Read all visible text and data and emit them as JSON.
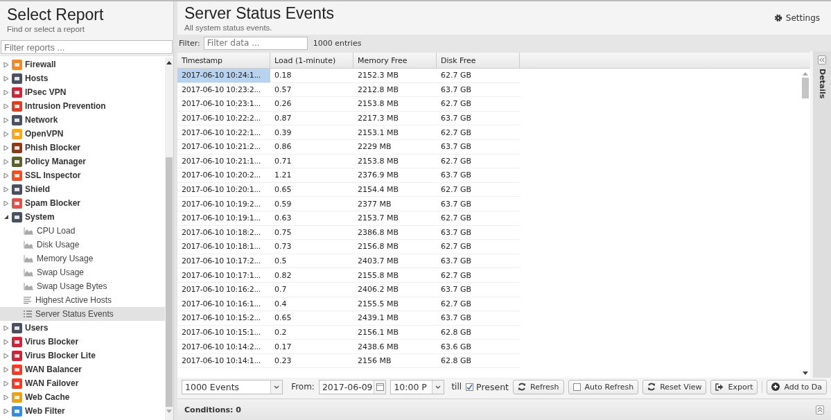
{
  "sidebar": {
    "title": "Select Report",
    "subtitle": "Find or select a report",
    "filter": {
      "placeholder": "Filter reports ..."
    },
    "tree": [
      {
        "label": "Firewall",
        "color": "#f0892c",
        "expanded": false
      },
      {
        "label": "Hosts",
        "color": "#4a5060",
        "expanded": false
      },
      {
        "label": "IPsec VPN",
        "color": "#c8283c",
        "expanded": false
      },
      {
        "label": "Intrusion Prevention",
        "color": "#d8402a",
        "expanded": false
      },
      {
        "label": "Network",
        "color": "#4a5060",
        "expanded": false
      },
      {
        "label": "OpenVPN",
        "color": "#f5a623",
        "expanded": false
      },
      {
        "label": "Phish Blocker",
        "color": "#8a3a1c",
        "expanded": false
      },
      {
        "label": "Policy Manager",
        "color": "#5a6030",
        "expanded": false
      },
      {
        "label": "SSL Inspector",
        "color": "#e8502a",
        "expanded": false
      },
      {
        "label": "Shield",
        "color": "#4a5060",
        "expanded": false
      },
      {
        "label": "Spam Blocker",
        "color": "#d9534f",
        "expanded": false
      },
      {
        "label": "System",
        "color": "#4a5060",
        "expanded": true,
        "children": [
          {
            "label": "CPU Load",
            "kind": "chart",
            "selected": false
          },
          {
            "label": "Disk Usage",
            "kind": "chart",
            "selected": false
          },
          {
            "label": "Memory Usage",
            "kind": "chart",
            "selected": false
          },
          {
            "label": "Swap Usage",
            "kind": "chart",
            "selected": false
          },
          {
            "label": "Swap Usage Bytes",
            "kind": "chart",
            "selected": false
          },
          {
            "label": "Highest Active Hosts",
            "kind": "text",
            "selected": false
          },
          {
            "label": "Server Status Events",
            "kind": "events",
            "selected": true
          }
        ]
      },
      {
        "label": "Users",
        "color": "#4a5060",
        "expanded": false
      },
      {
        "label": "Virus Blocker",
        "color": "#c8283c",
        "expanded": false
      },
      {
        "label": "Virus Blocker Lite",
        "color": "#c8283c",
        "expanded": false
      },
      {
        "label": "WAN Balancer",
        "color": "#e8402a",
        "expanded": false
      },
      {
        "label": "WAN Failover",
        "color": "#e8402a",
        "expanded": false
      },
      {
        "label": "Web Cache",
        "color": "#e8a020",
        "expanded": false
      },
      {
        "label": "Web Filter",
        "color": "#3a8ad8",
        "expanded": false
      }
    ]
  },
  "report": {
    "title": "Server Status Events",
    "subtitle": "All system status events.",
    "settings": "Settings"
  },
  "filter_bar": {
    "label": "Filter:",
    "placeholder": "Filter data ...",
    "count": "1000 entries"
  },
  "table": {
    "columns": [
      "Timestamp",
      "Load (1-minute)",
      "Memory Free",
      "Disk Free"
    ],
    "rows": [
      {
        "cells": [
          "2017-06-10 10:24:1...",
          "0.18",
          "2152.3 MB",
          "62.7 GB"
        ],
        "selected": true
      },
      {
        "cells": [
          "2017-06-10 10:23:2...",
          "0.57",
          "2212.8 MB",
          "63.7 GB"
        ],
        "selected": false
      },
      {
        "cells": [
          "2017-06-10 10:23:1...",
          "0.26",
          "2153.8 MB",
          "62.7 GB"
        ],
        "selected": false
      },
      {
        "cells": [
          "2017-06-10 10:22:2...",
          "0.87",
          "2217.3 MB",
          "63.7 GB"
        ],
        "selected": false
      },
      {
        "cells": [
          "2017-06-10 10:22:1...",
          "0.39",
          "2153.1 MB",
          "62.7 GB"
        ],
        "selected": false
      },
      {
        "cells": [
          "2017-06-10 10:21:2...",
          "0.86",
          "2229 MB",
          "63.7 GB"
        ],
        "selected": false
      },
      {
        "cells": [
          "2017-06-10 10:21:1...",
          "0.71",
          "2153.8 MB",
          "62.7 GB"
        ],
        "selected": false
      },
      {
        "cells": [
          "2017-06-10 10:20:2...",
          "1.21",
          "2376.9 MB",
          "63.7 GB"
        ],
        "selected": false
      },
      {
        "cells": [
          "2017-06-10 10:20:1...",
          "0.65",
          "2154.4 MB",
          "62.7 GB"
        ],
        "selected": false
      },
      {
        "cells": [
          "2017-06-10 10:19:2...",
          "0.59",
          "2377 MB",
          "63.7 GB"
        ],
        "selected": false
      },
      {
        "cells": [
          "2017-06-10 10:19:1...",
          "0.63",
          "2153.7 MB",
          "62.7 GB"
        ],
        "selected": false
      },
      {
        "cells": [
          "2017-06-10 10:18:2...",
          "0.75",
          "2386.8 MB",
          "63.7 GB"
        ],
        "selected": false
      },
      {
        "cells": [
          "2017-06-10 10:18:1...",
          "0.73",
          "2156.8 MB",
          "62.7 GB"
        ],
        "selected": false
      },
      {
        "cells": [
          "2017-06-10 10:17:2...",
          "0.5",
          "2403.7 MB",
          "63.7 GB"
        ],
        "selected": false
      },
      {
        "cells": [
          "2017-06-10 10:17:1...",
          "0.82",
          "2155.8 MB",
          "62.7 GB"
        ],
        "selected": false
      },
      {
        "cells": [
          "2017-06-10 10:16:2...",
          "0.7",
          "2406.2 MB",
          "63.7 GB"
        ],
        "selected": false
      },
      {
        "cells": [
          "2017-06-10 10:16:1...",
          "0.4",
          "2155.5 MB",
          "62.7 GB"
        ],
        "selected": false
      },
      {
        "cells": [
          "2017-06-10 10:15:2...",
          "0.65",
          "2439.1 MB",
          "63.7 GB"
        ],
        "selected": false
      },
      {
        "cells": [
          "2017-06-10 10:15:1...",
          "0.2",
          "2156.1 MB",
          "62.8 GB"
        ],
        "selected": false
      },
      {
        "cells": [
          "2017-06-10 10:14:2...",
          "0.17",
          "2438.6 MB",
          "63.6 GB"
        ],
        "selected": false
      },
      {
        "cells": [
          "2017-06-10 10:14:1...",
          "0.23",
          "2156 MB",
          "62.8 GB"
        ],
        "selected": false
      }
    ]
  },
  "details_panel": {
    "label": "Details"
  },
  "toolbar": {
    "limit": "1000 Events",
    "from_label": "From:",
    "date": "2017-06-09",
    "time": "10:00 P",
    "till_label": "till",
    "present": {
      "label": "Present",
      "checked": true
    },
    "buttons": [
      {
        "label": "Refresh",
        "kind": "refresh"
      },
      {
        "label": "Auto Refresh",
        "kind": "toggle",
        "checked": false
      },
      {
        "label": "Reset View",
        "kind": "refresh"
      },
      {
        "label": "Export",
        "kind": "export"
      },
      {
        "label": "Add to Da",
        "kind": "add"
      }
    ]
  },
  "conditions": {
    "label": "Conditions: 0"
  }
}
